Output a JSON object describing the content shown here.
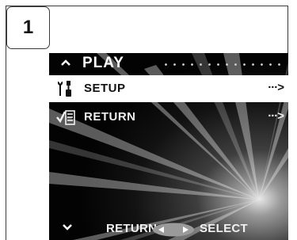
{
  "step": {
    "number": "1"
  },
  "menu": {
    "title": "PLAY",
    "items": [
      {
        "label": "SETUP",
        "arrow": "···>",
        "icon": "wrench-screwdriver-icon",
        "selected": true
      },
      {
        "label": "RETURN",
        "arrow": "···>",
        "icon": "checklist-icon",
        "selected": false
      }
    ]
  },
  "footer": {
    "left_label": "RETURN",
    "right_label": "SELECT",
    "icon": "left-right-pad-icon"
  },
  "colors": {
    "screen_background": "#000000",
    "highlight": "#ffffff",
    "text": "#f0f0f0"
  }
}
